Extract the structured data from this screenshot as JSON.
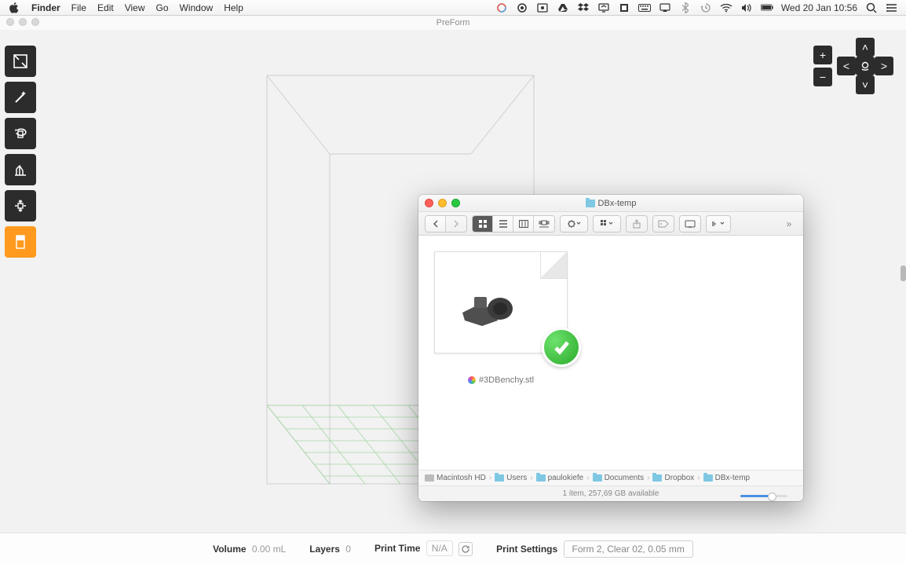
{
  "menubar": {
    "app": "Finder",
    "items": [
      "File",
      "Edit",
      "View",
      "Go",
      "Window",
      "Help"
    ],
    "datetime": "Wed 20 Jan  10:56"
  },
  "app": {
    "title": "PreForm"
  },
  "toolbar_left": [
    {
      "name": "scale-tool"
    },
    {
      "name": "magic-wand-tool"
    },
    {
      "name": "rotate-tool"
    },
    {
      "name": "supports-tool"
    },
    {
      "name": "layout-tool"
    },
    {
      "name": "layers-tool"
    }
  ],
  "nav": {
    "zoom_in": "+",
    "zoom_out": "−",
    "up": "˄",
    "down": "˅",
    "left": "<",
    "right": ">"
  },
  "status": {
    "volume_label": "Volume",
    "volume_value": "0.00 mL",
    "layers_label": "Layers",
    "layers_value": "0",
    "printtime_label": "Print Time",
    "printtime_value": "N/A",
    "settings_label": "Print Settings",
    "settings_value": "Form 2, Clear 02, 0.05 mm"
  },
  "finder": {
    "title": "DBx-temp",
    "file": {
      "name": "#3DBenchy.stl"
    },
    "path": [
      "Macintosh HD",
      "Users",
      "paulokiefe",
      "Documents",
      "Dropbox",
      "DBx-temp"
    ],
    "status": "1 item, 257,69 GB available"
  }
}
